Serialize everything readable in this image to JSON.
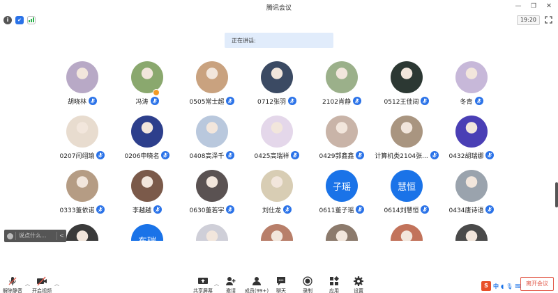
{
  "window": {
    "title": "腾讯会议"
  },
  "status": {
    "time": "19:20"
  },
  "speaking": {
    "label": "正在讲话:"
  },
  "participants": [
    {
      "name": "胡晓林",
      "avatar": "photo",
      "color": "#b8a9c6"
    },
    {
      "name": "冯涛",
      "avatar": "photo",
      "color": "#8aa86e"
    },
    {
      "name": "0505常士超",
      "avatar": "photo",
      "color": "#c9a27f"
    },
    {
      "name": "0712张羽",
      "avatar": "photo",
      "color": "#3b4a63"
    },
    {
      "name": "2102肖静",
      "avatar": "photo",
      "color": "#9bb08a"
    },
    {
      "name": "0512王佳阔",
      "avatar": "photo",
      "color": "#2c3833"
    },
    {
      "name": "冬青",
      "avatar": "photo",
      "color": "#c7b8d9"
    },
    {
      "name": "0207闫翊瑜",
      "avatar": "photo",
      "color": "#e8dccf"
    },
    {
      "name": "0206申晓名",
      "avatar": "photo",
      "color": "#2d3f8c"
    },
    {
      "name": "0408高泽千",
      "avatar": "photo",
      "color": "#b9c8dd"
    },
    {
      "name": "0425高瑞祥",
      "avatar": "photo",
      "color": "#e4d7ea"
    },
    {
      "name": "0429郭鑫鑫",
      "avatar": "photo",
      "color": "#c9b4a8"
    },
    {
      "name": "计算机类2104张...",
      "avatar": "photo",
      "color": "#a99580"
    },
    {
      "name": "0432胡瑞娜",
      "avatar": "photo",
      "color": "#4a3fb5"
    },
    {
      "name": "0333董依诺",
      "avatar": "photo",
      "color": "#b59c84"
    },
    {
      "name": "李越越",
      "avatar": "photo",
      "color": "#7b5a4a"
    },
    {
      "name": "0630董若宇",
      "avatar": "photo",
      "color": "#5a5252"
    },
    {
      "name": "刘仕龙",
      "avatar": "photo",
      "color": "#d8cdb4"
    },
    {
      "name": "0611董子瑶",
      "avatar": "text",
      "text": "子瑶",
      "color": "#1a73e8"
    },
    {
      "name": "0614刘慧恒",
      "avatar": "text",
      "text": "慧恒",
      "color": "#1a73e8"
    },
    {
      "name": "0434唐诗语",
      "avatar": "photo",
      "color": "#9aa3ad"
    },
    {
      "name": "",
      "avatar": "photo",
      "color": "#3a3a3a"
    },
    {
      "name": "",
      "avatar": "text",
      "text": "东瑞",
      "color": "#1a73e8"
    },
    {
      "name": "",
      "avatar": "photo",
      "color": "#cfcfd8"
    },
    {
      "name": "",
      "avatar": "photo",
      "color": "#b87f6a"
    },
    {
      "name": "",
      "avatar": "photo",
      "color": "#8c7a6c"
    },
    {
      "name": "",
      "avatar": "photo",
      "color": "#c2735b"
    },
    {
      "name": "",
      "avatar": "photo",
      "color": "#4a4a4a"
    }
  ],
  "chat": {
    "placeholder": "说点什么...",
    "collapse": "<"
  },
  "toolbar": {
    "mute": "解除静音",
    "video": "开启视频",
    "share": "共享屏幕",
    "invite": "邀请",
    "members": "成员(99+)",
    "chat": "聊天",
    "record": "录制",
    "apps": "应用",
    "settings": "设置",
    "end": "离开会议"
  },
  "ime": {
    "logo": "S",
    "lang": "中"
  },
  "colors": {
    "accent": "#1a73e8",
    "end": "#e25b4b",
    "signal": "#2bb24c"
  }
}
